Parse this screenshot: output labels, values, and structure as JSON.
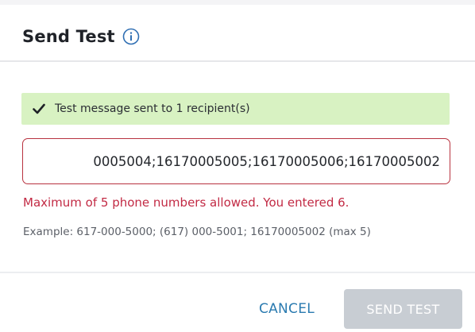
{
  "dialog": {
    "title": "Send Test",
    "info_icon": "info-circle-icon"
  },
  "success_banner": {
    "icon": "checkmark-icon",
    "message": "Test message sent to 1 recipient(s)",
    "background_color": "#d8f2c2"
  },
  "phone_input": {
    "value": "0005004;16170005005;16170005006;16170005002",
    "border_color": "#b8323f"
  },
  "validation": {
    "error": "Maximum of 5 phone numbers allowed. You entered 6.",
    "error_color": "#c22a44",
    "example": "Example: 617-000-5000; (617) 000-5001; 16170005002 (max 5)"
  },
  "footer": {
    "cancel_label": "CANCEL",
    "send_test_label": "SEND TEST",
    "cancel_color": "#2b7bb0",
    "send_test_disabled_color": "#c8cdd3"
  }
}
